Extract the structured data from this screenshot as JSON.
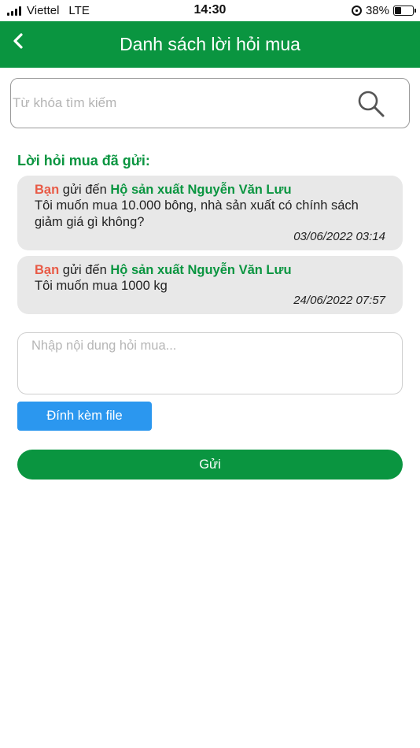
{
  "status_bar": {
    "carrier": "Viettel",
    "network": "LTE",
    "time": "14:30",
    "battery_text": "38%",
    "battery_level": 0.38
  },
  "header": {
    "title": "Danh sách lời hỏi mua",
    "back_icon": "chevron-left-icon",
    "bg_color": "#0a9540"
  },
  "search": {
    "placeholder": "Từ khóa tìm kiếm",
    "value": "",
    "icon": "search-icon"
  },
  "section": {
    "title": "Lời hỏi mua đã gửi:"
  },
  "messages": [
    {
      "sender": "Bạn",
      "to_label": "gửi đến",
      "recipient": "Hộ sản xuất Nguyễn Văn Lưu",
      "text": "Tôi muốn mua 10.000 bông, nhà sản xuất có chính sách giảm giá gì không?",
      "time": "03/06/2022 03:14"
    },
    {
      "sender": "Bạn",
      "to_label": "gửi đến",
      "recipient": "Hộ sản xuất Nguyễn Văn Lưu",
      "text": "Tôi muốn mua 1000 kg",
      "time": "24/06/2022 07:57"
    }
  ],
  "compose": {
    "placeholder": "Nhập nội dung hỏi mua...",
    "value": ""
  },
  "buttons": {
    "attach_label": "Đính kèm file",
    "send_label": "Gửi"
  },
  "colors": {
    "primary_green": "#0a9540",
    "attach_blue": "#2b97ef",
    "sender_red": "#e85a46",
    "card_bg": "#e8e8e8"
  }
}
